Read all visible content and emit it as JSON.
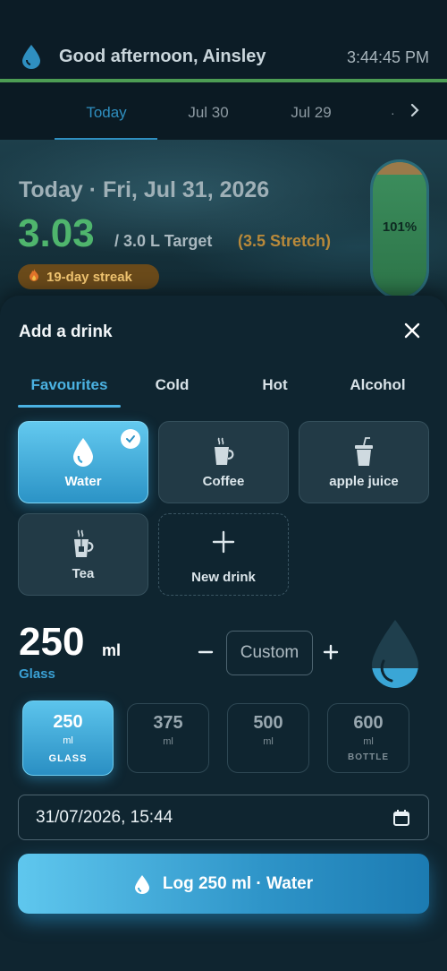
{
  "header": {
    "greeting": "Good afternoon, Ainsley",
    "time": "3:44:45 PM"
  },
  "date_tabs": {
    "items": [
      "Today",
      "Jul 30",
      "Jul 29"
    ],
    "more": "·"
  },
  "hero": {
    "title": "Today · Fri, Jul 31, 2026",
    "amount": "3.03",
    "target": "/ 3.0 L Target",
    "stretch": "(3.5 Stretch)",
    "streak": "19-day streak",
    "progress_label": "101%",
    "progress_fraction": 1.01
  },
  "sheet": {
    "title": "Add a drink",
    "categories": [
      "Favourites",
      "Cold",
      "Hot",
      "Alcohol"
    ],
    "drinks": [
      {
        "label": "Water",
        "icon": "water-drop-icon",
        "selected": true
      },
      {
        "label": "Coffee",
        "icon": "coffee-cup-icon"
      },
      {
        "label": "apple juice",
        "icon": "juice-cup-icon"
      },
      {
        "label": "Tea",
        "icon": "tea-cup-icon"
      },
      {
        "label": "New drink",
        "icon": "plus-icon"
      }
    ],
    "amount": {
      "value": "250",
      "unit": "ml",
      "size_name": "Glass",
      "custom_placeholder": "Custom"
    },
    "sizes": [
      {
        "value": "250",
        "unit": "ml",
        "name": "GLASS",
        "selected": true
      },
      {
        "value": "375",
        "unit": "ml",
        "name": ""
      },
      {
        "value": "500",
        "unit": "ml",
        "name": ""
      },
      {
        "value": "600",
        "unit": "ml",
        "name": "BOTTLE"
      }
    ],
    "datetime": "31/07/2026, 15:44",
    "log_button": "Log 250 ml · Water"
  },
  "colors": {
    "accent": "#4bb2e2",
    "progress_green": "#4fb56d",
    "stretch_gold": "#b8893a",
    "header_line": "#4d9d54"
  }
}
